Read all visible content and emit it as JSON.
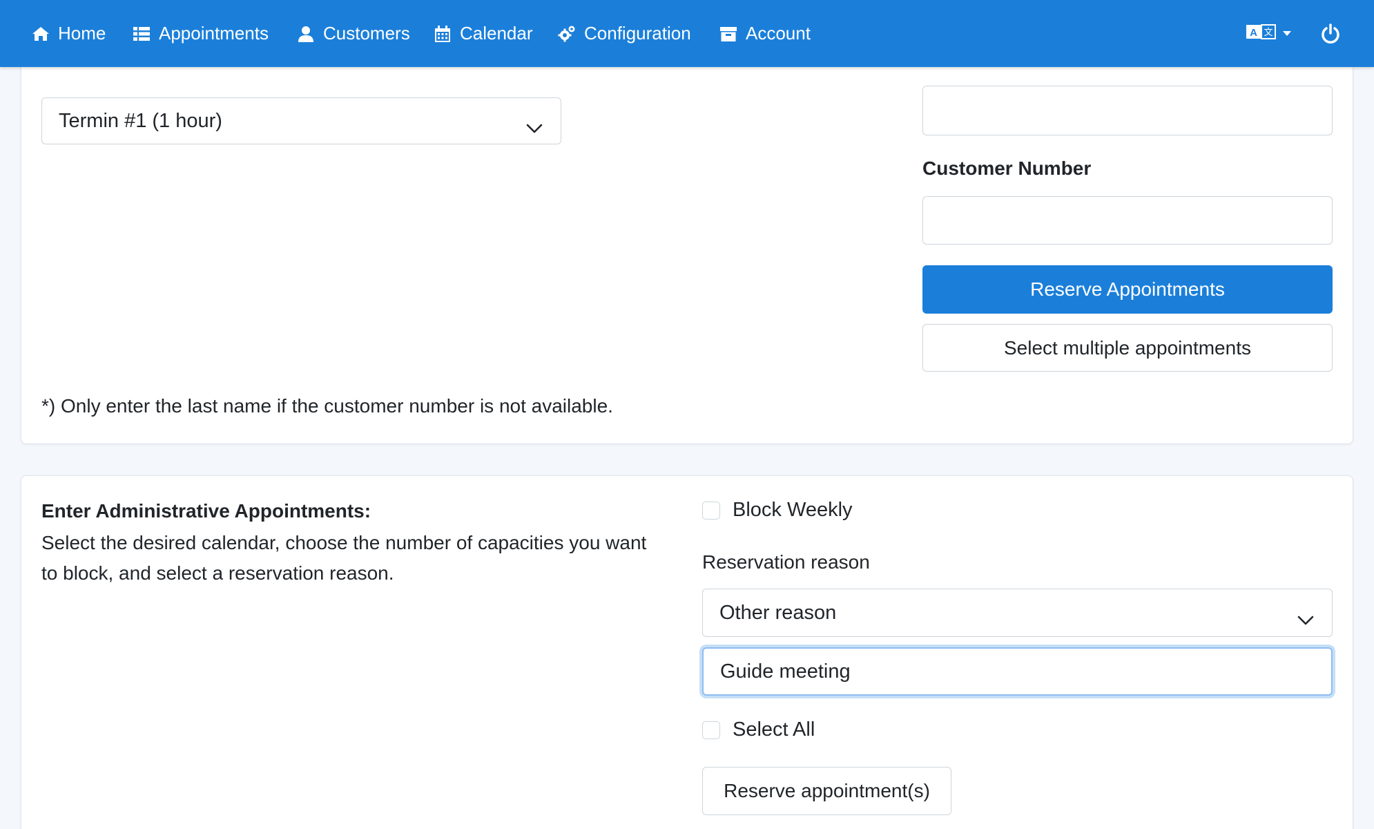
{
  "nav": {
    "items": [
      {
        "label": "Home",
        "icon": "home-icon"
      },
      {
        "label": "Appointments",
        "icon": "list-icon"
      },
      {
        "label": "Customers",
        "icon": "user-icon"
      },
      {
        "label": "Calendar",
        "icon": "calendar-icon"
      },
      {
        "label": "Configuration",
        "icon": "cogs-icon"
      },
      {
        "label": "Account",
        "icon": "archive-icon"
      }
    ],
    "color": "#1b7fda"
  },
  "reserve_form": {
    "service_select": "Termin #1 (1 hour)",
    "lastname_value": "",
    "customer_number_label": "Customer Number",
    "customer_number_value": "",
    "reserve_button": "Reserve Appointments",
    "multi_button": "Select multiple appointments",
    "note": "*) Only enter the last name if the customer number is not available."
  },
  "admin": {
    "heading": "Enter Administrative Appointments:",
    "description": "Select the desired calendar, choose the number of capacities you want to block, and select a reservation reason.",
    "block_weekly_label": "Block Weekly",
    "reason_label": "Reservation reason",
    "reason_select": "Other reason",
    "reason_text": "Guide meeting",
    "select_all_label": "Select All",
    "reserve_button": "Reserve appointment(s)"
  }
}
